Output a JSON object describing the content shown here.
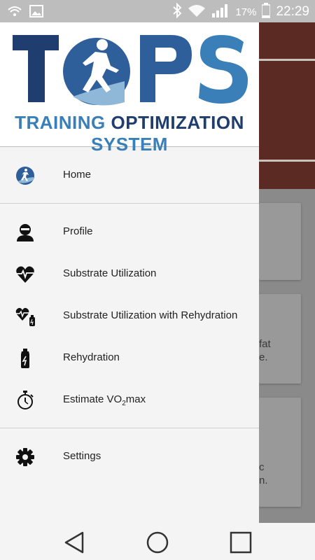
{
  "status_bar": {
    "battery_percent": "17%",
    "time": "22:29",
    "icons": [
      "wifi-call-icon",
      "image-icon",
      "bluetooth-icon",
      "wifi-icon",
      "signal-icon",
      "battery-icon"
    ]
  },
  "logo": {
    "title": "TOPS",
    "subtitle_word_1": "TRAINING",
    "subtitle_word_2": "OPTIMIZATION",
    "subtitle_word_3": "SYSTEM",
    "colors": {
      "navy": "#1f3d6e",
      "blue": "#3a7fb8",
      "light_blue": "#8fb8d8"
    }
  },
  "menu": {
    "home": {
      "label": "Home",
      "icon": "runner-logo-icon"
    },
    "profile": {
      "label": "Profile",
      "icon": "person-icon"
    },
    "substrate": {
      "label": "Substrate Utilization",
      "icon": "heart-pulse-icon"
    },
    "substrate_rehydration": {
      "label": "Substrate Utilization with Rehydration",
      "icon": "heart-bottle-icon"
    },
    "rehydration": {
      "label": "Rehydration",
      "icon": "bottle-icon"
    },
    "vo2": {
      "label_prefix": "Estimate VO",
      "label_sub": "2",
      "label_suffix": "max",
      "icon": "stopwatch-icon"
    },
    "settings": {
      "label": "Settings",
      "icon": "gear-icon"
    }
  },
  "background": {
    "card2_text": "fat\ne.",
    "card3_text": "c\nn."
  }
}
